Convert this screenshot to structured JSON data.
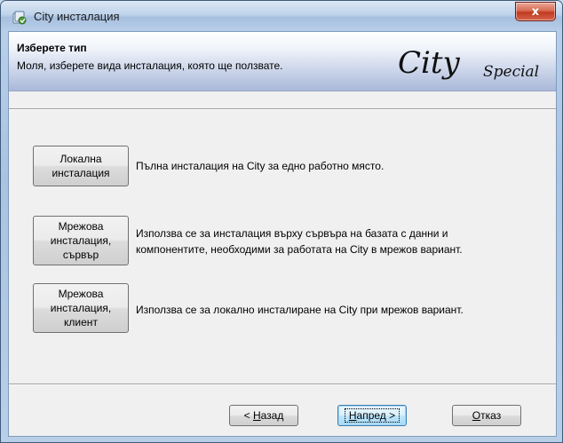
{
  "window": {
    "title": "City инсталация",
    "close_label": "x"
  },
  "banner": {
    "title": "Изберете тип",
    "subtitle": "Моля, изберете вида инсталация, която ще ползвате.",
    "logo_main": "City",
    "logo_sub": "Special"
  },
  "options": [
    {
      "button_label": "Локална\nинсталация",
      "description": "Пълна инсталация на City за едно работно място."
    },
    {
      "button_label": "Мрежова\nинсталация,\nсървър",
      "description_line1": "Използва се за инсталация върху сървъра на базата с данни и",
      "description_line2": "компонентите, необходими за работата на City в мрежов вариант."
    },
    {
      "button_label": "Мрежова\nинсталация,\nклиент",
      "description": "Използва се за локално инсталиране на City при мрежов вариант."
    }
  ],
  "nav": {
    "back_mnemonic": "Н",
    "back_rest": "азад",
    "back_prefix": "< ",
    "next_mnemonic": "Н",
    "next_rest": "апред",
    "next_suffix": " >",
    "cancel_mnemonic": "О",
    "cancel_rest": "тказ"
  }
}
